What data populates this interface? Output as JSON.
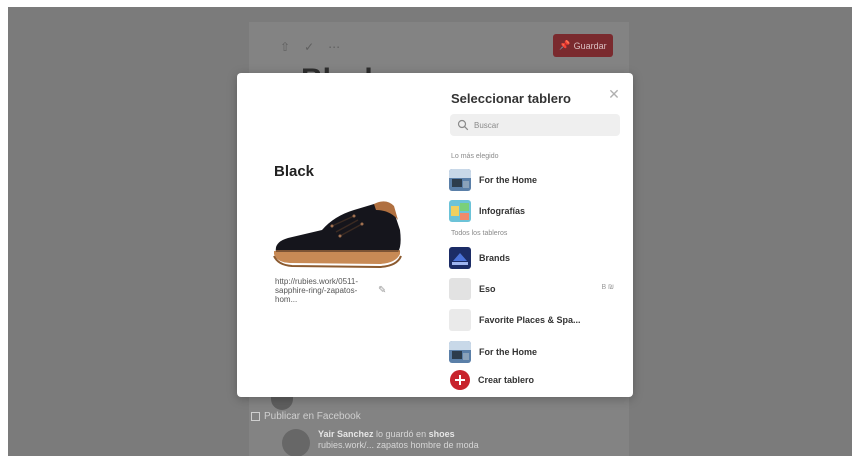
{
  "background": {
    "title": "Black",
    "save_label": "Guardar",
    "publish_facebook": "Publicar en Facebook",
    "activity": {
      "line1_user": "Yair Sanchez",
      "line1_rest": " lo guardó en ",
      "line1_board": "shoes",
      "line2": "rubies.work/... zapatos hombre de moda"
    }
  },
  "pin": {
    "title": "Black",
    "url": "http://rubies.work/0511-sapphire-ring/-zapatos-hom..."
  },
  "panel": {
    "title": "Seleccionar tablero",
    "search_placeholder": "Buscar",
    "section_top": "Lo más elegido",
    "section_all": "Todos los tableros",
    "top_boards": [
      {
        "name": "For the Home"
      },
      {
        "name": "Infografías"
      }
    ],
    "all_boards": [
      {
        "name": "Brands"
      },
      {
        "name": "Eso",
        "extra": "B ₪"
      },
      {
        "name": "Favorite Places & Spa..."
      },
      {
        "name": "For the Home"
      }
    ],
    "create_label": "Crear tablero"
  },
  "colors": {
    "accent": "#c8232c",
    "overlay": "#7b7b7b"
  }
}
